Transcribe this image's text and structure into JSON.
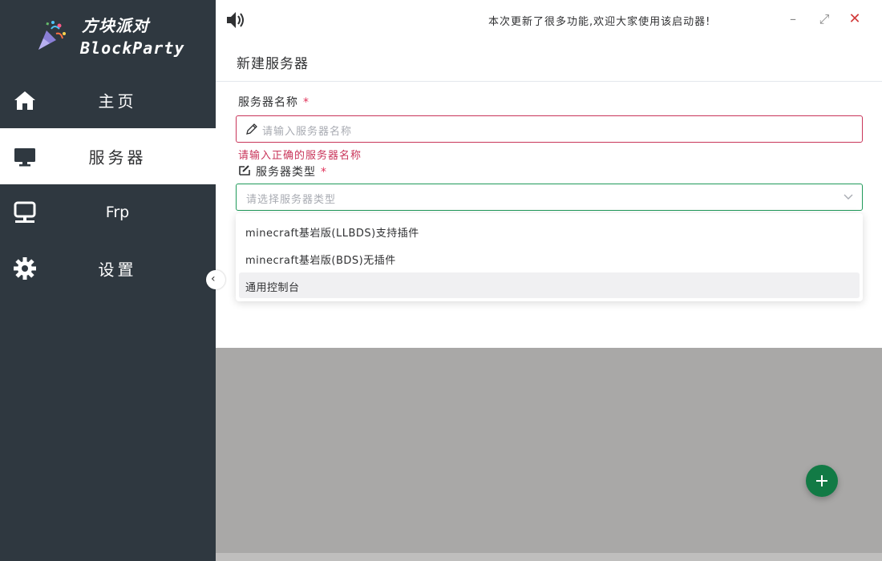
{
  "app": {
    "logo_title": "方块派对",
    "logo_subtitle": "BlockParty"
  },
  "sidebar": {
    "items": [
      {
        "label": "主页",
        "icon": "home-icon",
        "active": false
      },
      {
        "label": "服务器",
        "icon": "monitor-icon",
        "active": true
      },
      {
        "label": "Frp",
        "icon": "network-computer-icon",
        "active": false
      },
      {
        "label": "设置",
        "icon": "gear-icon",
        "active": false
      }
    ],
    "collapse_glyph": "‹"
  },
  "titlebar": {
    "notice": "本次更新了很多功能,欢迎大家使用该启动器!",
    "minimize": "–",
    "maximize": "⤢",
    "close": "✕"
  },
  "dialog": {
    "title": "新建服务器",
    "name_label": "服务器名称",
    "required_mark": "*",
    "name_placeholder": "请输入服务器名称",
    "name_error": "请输入正确的服务器名称",
    "type_label": "服务器类型",
    "type_placeholder": "请选择服务器类型",
    "type_options": [
      "minecraft基岩版(LLBDS)支持插件",
      "minecraft基岩版(BDS)无插件",
      "通用控制台"
    ]
  },
  "colors": {
    "sidebar_bg": "#2f3840",
    "accent_green": "#127a45",
    "error_red": "#c9355a",
    "select_focus": "#1f9a5a"
  }
}
